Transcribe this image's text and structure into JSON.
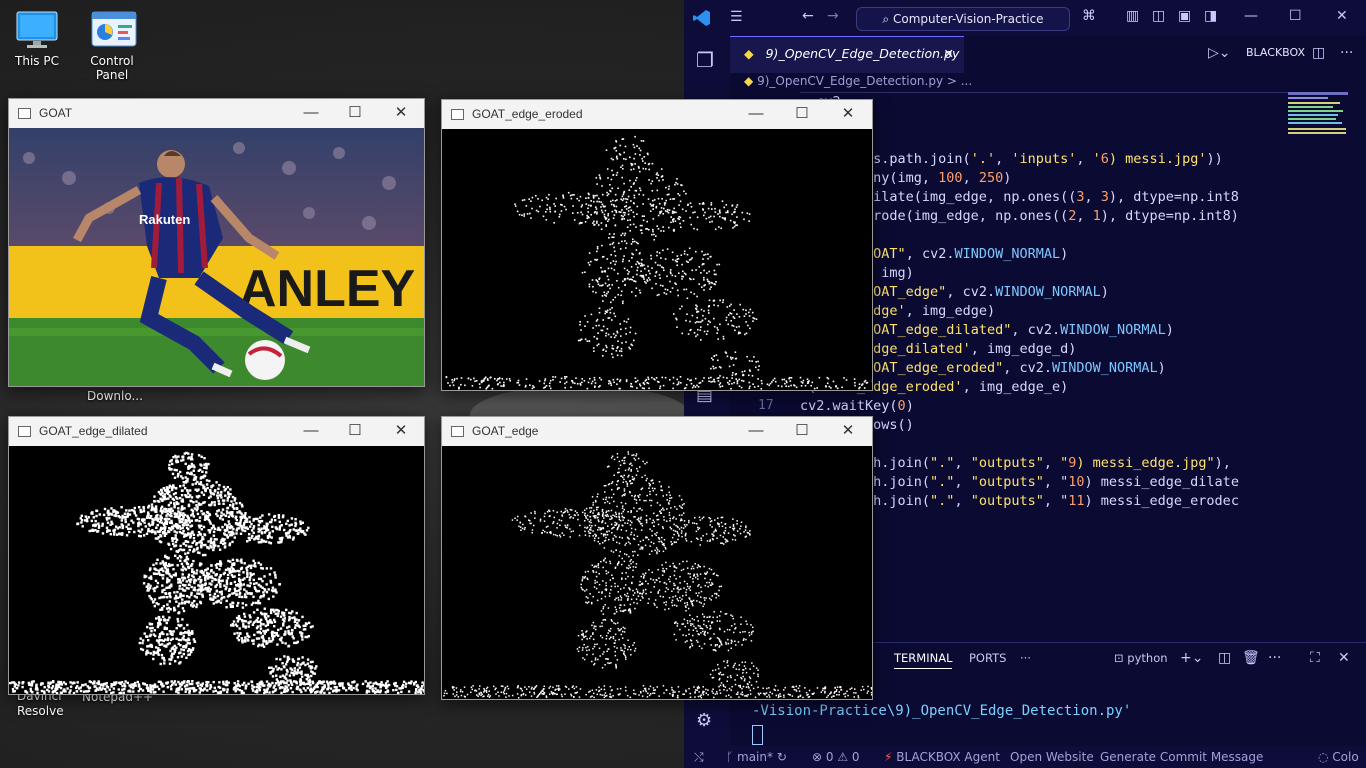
{
  "desktop": {
    "icons": [
      {
        "label_line1": "This PC",
        "label_line2": ""
      },
      {
        "label_line1": "Control",
        "label_line2": "Panel"
      }
    ],
    "partial_labels": [
      "Downlo...",
      "Resolve",
      "Davinci",
      "Notepad++"
    ]
  },
  "windows": {
    "goat": {
      "title": "GOAT",
      "banner_text": "ANLEY",
      "shirt_text": "Rakuten"
    },
    "eroded": {
      "title": "GOAT_edge_eroded"
    },
    "dilated": {
      "title": "GOAT_edge_dilated"
    },
    "edge": {
      "title": "GOAT_edge"
    }
  },
  "controls": {
    "minimize": "—",
    "maximize": "☐",
    "close": "✕"
  },
  "vscode": {
    "search": "Computer-Vision-Practice",
    "tab": "9)_OpenCV_Edge_Detection.py",
    "breadcrumb": "9)_OpenCV_Edge_Detection.py > ...",
    "run_label": "BLACKBOX",
    "lines": [
      {
        "n": "",
        "t": ", cv2"
      },
      {
        "n": "",
        "t": "mpy as np"
      },
      {
        "n": "",
        "t": ""
      },
      {
        "n": "",
        "t": ".imread(os.path.join('.', 'inputs', '6) messi.jpg'))"
      },
      {
        "n": "",
        "t": "= cv2.Canny(img, 100, 250)"
      },
      {
        "n": "",
        "t": "d = cv2.dilate(img_edge, np.ones((3, 3), dtype=np.int8"
      },
      {
        "n": "",
        "t": "e = cv2.erode(img_edge, np.ones((2, 1), dtype=np.int8)"
      },
      {
        "n": "",
        "t": ""
      },
      {
        "n": "",
        "t": "Window(\"GOAT\", cv2.WINDOW_NORMAL)"
      },
      {
        "n": "",
        "t": "w('GOAT', img)"
      },
      {
        "n": "",
        "t": "Window(\"GOAT_edge\", cv2.WINDOW_NORMAL)"
      },
      {
        "n": "",
        "t": "w('GOAT_edge', img_edge)"
      },
      {
        "n": "",
        "t": "Window(\"GOAT_edge_dilated\", cv2.WINDOW_NORMAL)"
      },
      {
        "n": "",
        "t": "w('GOAT_edge_dilated', img_edge_d)"
      },
      {
        "n": "",
        "t": "Window(\"GOAT_edge_eroded\", cv2.WINDOW_NORMAL)"
      },
      {
        "n": "",
        "t": "w('GOAT_edge_eroded', img_edge_e)"
      },
      {
        "n": "17",
        "t": "cv2.waitKey(0)"
      },
      {
        "n": "",
        "t": "oyAllWindows()"
      },
      {
        "n": "",
        "t": ""
      },
      {
        "n": "",
        "t": "te(os.path.join(\".\", \"outputs\", \"9) messi_edge.jpg\"),"
      },
      {
        "n": "",
        "t": "te(os.path.join(\".\", \"outputs\", \"10) messi_edge_dilate"
      },
      {
        "n": "",
        "t": "te(os.path.join(\".\", \"outputs\", \"11) messi_edge_erodec"
      }
    ],
    "panel_tabs": [
      "TERMINAL",
      "PORTS",
      "···"
    ],
    "terminal_shell": "python",
    "terminal_line": "-Vision-Practice\\9)_OpenCV_Edge_Detection.py'",
    "status": {
      "branch": "main*",
      "problems": "⊗ 0 ⚠ 0",
      "blackbox_agent": "BLACKBOX Agent",
      "open_website": "Open Website",
      "commit": "Generate Commit Message",
      "color": "Colo"
    }
  }
}
